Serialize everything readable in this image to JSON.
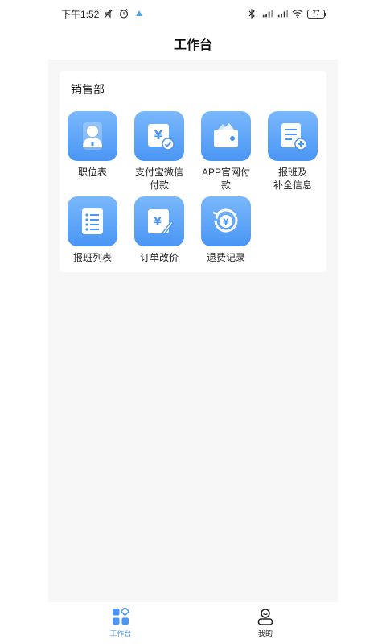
{
  "status_bar": {
    "time": "下午1:52",
    "battery": "77",
    "icons": [
      "mute-icon",
      "alarm-icon",
      "app-notification-icon",
      "bluetooth-icon",
      "signal-icon",
      "signal-icon",
      "wifi-icon",
      "battery-icon"
    ]
  },
  "header": {
    "title": "工作台"
  },
  "section": {
    "title": "销售部",
    "items": [
      {
        "label": "职位表",
        "icon": "person-icon"
      },
      {
        "label": "支付宝微信\n付款",
        "icon": "payment-check-icon"
      },
      {
        "label": "APP官网付\n款",
        "icon": "wallet-icon"
      },
      {
        "label": "报班及\n补全信息",
        "icon": "add-document-icon"
      },
      {
        "label": "报班列表",
        "icon": "list-icon"
      },
      {
        "label": "订单改价",
        "icon": "edit-price-icon"
      },
      {
        "label": "退费记录",
        "icon": "refund-icon"
      }
    ]
  },
  "bottom_nav": {
    "items": [
      {
        "label": "工作台",
        "icon": "workbench-icon",
        "active": true
      },
      {
        "label": "我的",
        "icon": "profile-icon",
        "active": false
      }
    ]
  },
  "colors": {
    "accent": "#4a96f5",
    "tile_top": "#7ab8fb",
    "background": "#f7f7f7"
  }
}
